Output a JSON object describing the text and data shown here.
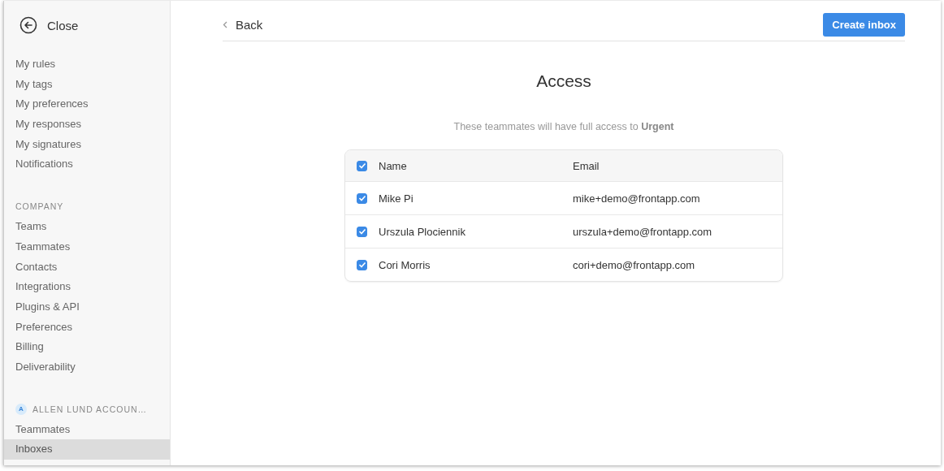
{
  "sidebar": {
    "close_label": "Close",
    "sections": [
      {
        "items": [
          {
            "label": "My rules",
            "selected": false
          },
          {
            "label": "My tags",
            "selected": false
          },
          {
            "label": "My preferences",
            "selected": false
          },
          {
            "label": "My responses",
            "selected": false
          },
          {
            "label": "My signatures",
            "selected": false
          },
          {
            "label": "Notifications",
            "selected": false
          }
        ]
      },
      {
        "header": "COMPANY",
        "items": [
          {
            "label": "Teams",
            "selected": false
          },
          {
            "label": "Teammates",
            "selected": false
          },
          {
            "label": "Contacts",
            "selected": false
          },
          {
            "label": "Integrations",
            "selected": false
          },
          {
            "label": "Plugins & API",
            "selected": false
          },
          {
            "label": "Preferences",
            "selected": false
          },
          {
            "label": "Billing",
            "selected": false
          },
          {
            "label": "Deliverability",
            "selected": false
          }
        ]
      },
      {
        "header": "ALLEN LUND ACCOUN…",
        "avatar": "A",
        "items": [
          {
            "label": "Teammates",
            "selected": false
          },
          {
            "label": "Inboxes",
            "selected": true
          }
        ]
      }
    ]
  },
  "topbar": {
    "back": "Back",
    "create_button": "Create inbox"
  },
  "title": "Access",
  "subtitle": "These teammates will have full access to **Urgent**",
  "table": {
    "all_checked": true,
    "columns": [
      "Name",
      "Email"
    ],
    "rows": [
      {
        "checked": true,
        "name": "Mike Pi",
        "email": "mike+demo@frontapp.com"
      },
      {
        "checked": true,
        "name": "Urszula Plociennik",
        "email": "urszula+demo@frontapp.com"
      },
      {
        "checked": true,
        "name": "Cori Morris",
        "email": "cori+demo@frontapp.com"
      }
    ]
  }
}
